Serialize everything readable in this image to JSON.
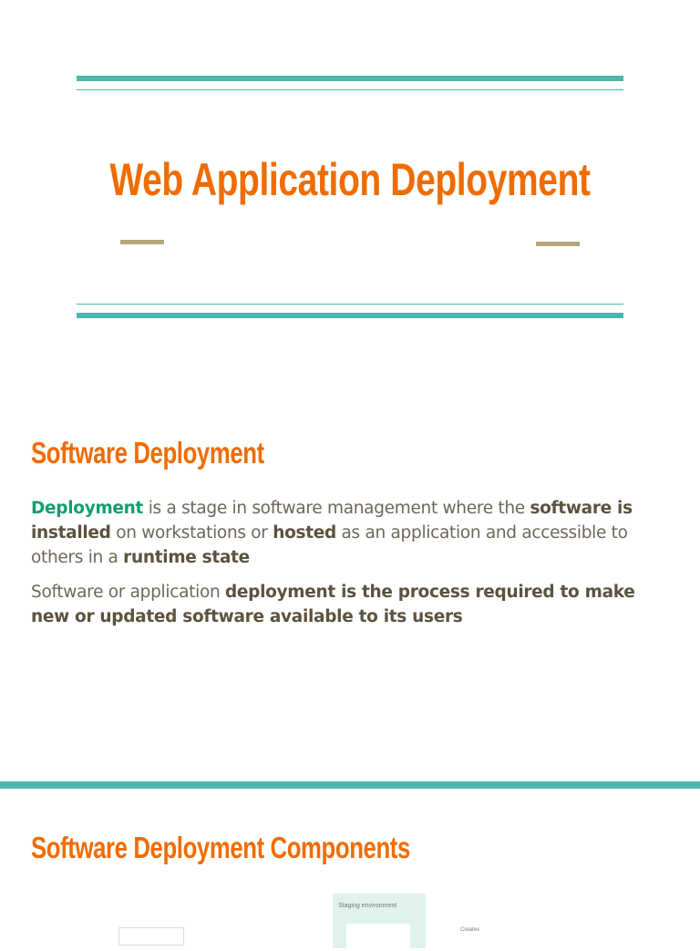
{
  "slide1": {
    "title": "Web Application Deployment"
  },
  "slide2": {
    "heading": "Software Deployment",
    "p1": {
      "s1": "Deployment",
      "s2": " is a stage in software management where the ",
      "s3": "software is installed",
      "s4": " on workstations or ",
      "s5": "hosted",
      "s6": " as an application and accessible to others in a ",
      "s7": "runtime state"
    },
    "p2": {
      "s1": "Software or application ",
      "s2": "deployment is the process required to make new or updated software available to its users"
    }
  },
  "slide3": {
    "heading": "Software Deployment Components",
    "diagram": {
      "staging_label": "Staging environment",
      "creates_label": "Creates"
    }
  },
  "colors": {
    "accent": "#ef6c00",
    "teal": "#4db6ac",
    "tan": "#b5a77a",
    "green": "#129e6e"
  }
}
